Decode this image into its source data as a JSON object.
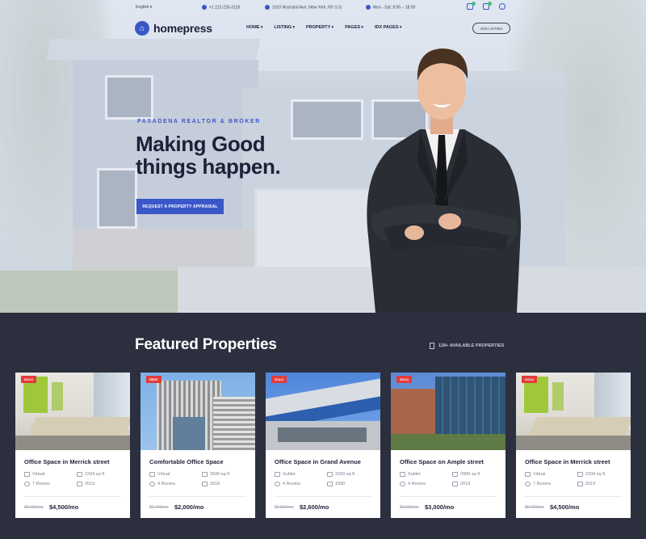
{
  "topbar": {
    "language": "English",
    "phone": "+1 212-226-3126",
    "address": "1010 Nostrand Ave, New York, NY U.S.",
    "hours": "Mon - Sat: 8.00 – 18.00",
    "icons": [
      "compare-icon",
      "heart-icon",
      "user-icon"
    ]
  },
  "brand": {
    "name": "homepress",
    "logo_glyph": "⌂"
  },
  "nav": {
    "items": [
      "HOME",
      "LISTING",
      "PROPERTY",
      "PAGES",
      "IDX PAGES"
    ],
    "add_listing": "ADD LISTING"
  },
  "hero": {
    "eyebrow": "PASADENA REALTOR & BROKER",
    "headline_line1": "Making Good",
    "headline_line2": "things happen.",
    "cta": "REQUEST A PROPERTY APPRAISAL"
  },
  "featured": {
    "title": "Featured Properties",
    "available": "128+ AVAILABLE PROPERTIES"
  },
  "cards": [
    {
      "tag": "SOLD",
      "title": "Office Space in Merrick street",
      "type": "Virtual",
      "area": "2334 sq ft",
      "rooms": "7 Rooms",
      "year": "2019",
      "old_price": "$5,000/mo",
      "price": "$4,500/mo"
    },
    {
      "tag": "RENT",
      "title": "Comfortable Office Space",
      "type": "Virtual",
      "area": "3000 sq ft",
      "rooms": "4 Rooms",
      "year": "2018",
      "old_price": "$2,400/mo",
      "price": "$2,000/mo"
    },
    {
      "tag": "SOLD",
      "title": "Office Space in Grand Avenue",
      "type": "Sublet",
      "area": "3200 sq ft",
      "rooms": "4 Rooms",
      "year": "1990",
      "old_price": "$2,800/mo",
      "price": "$2,600/mo"
    },
    {
      "tag": "SOLD",
      "title": "Office Space on Ample street",
      "type": "Sublet",
      "area": "2900 sq ft",
      "rooms": "4 Rooms",
      "year": "2019",
      "old_price": "$3,500/mo",
      "price": "$3,000/mo"
    },
    {
      "tag": "SOLD",
      "title": "Office Space in Merrick street",
      "type": "Virtual",
      "area": "2334 sq ft",
      "rooms": "7 Rooms",
      "year": "2019",
      "old_price": "$5,000/mo",
      "price": "$4,500/mo"
    }
  ],
  "colors": {
    "accent": "#3a57c9",
    "dark": "#2b2f3e",
    "sold": "#e33b3b"
  }
}
